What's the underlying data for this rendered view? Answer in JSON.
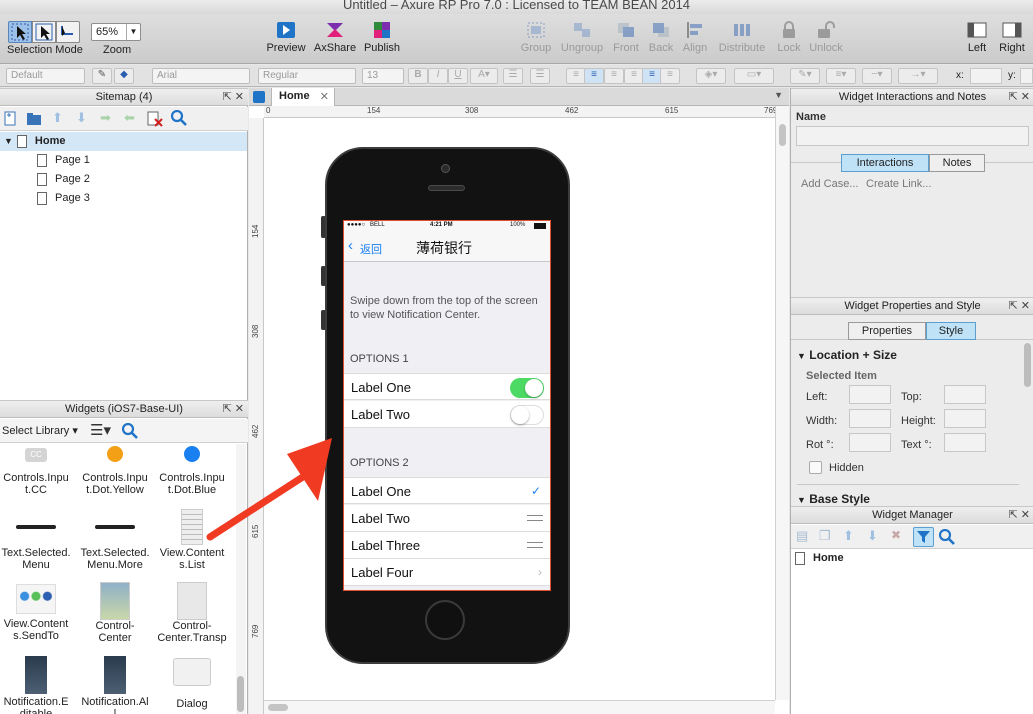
{
  "window": {
    "title": "Untitled – Axure RP Pro 7.0 : Licensed to TEAM BEAN 2014"
  },
  "toolbar": {
    "selection_mode": "Selection Mode",
    "zoom_value": "65%",
    "zoom_label": "Zoom",
    "preview": "Preview",
    "axshare": "AxShare",
    "publish": "Publish",
    "group": "Group",
    "ungroup": "Ungroup",
    "front": "Front",
    "back": "Back",
    "align": "Align",
    "distribute": "Distribute",
    "lock": "Lock",
    "unlock": "Unlock",
    "left": "Left",
    "right": "Right"
  },
  "format": {
    "style": "Default",
    "font": "Arial",
    "weight": "Regular",
    "size": "13",
    "bold": "B",
    "italic": "I",
    "underline": "U",
    "x_label": "x:",
    "y_label": "y:"
  },
  "sitemap": {
    "title": "Sitemap (4)",
    "home": "Home",
    "pages": [
      "Page 1",
      "Page 2",
      "Page 3"
    ]
  },
  "widgets": {
    "title": "Widgets (iOS7-Base-UI)",
    "select_library": "Select Library",
    "items": [
      {
        "l1": "Controls.Inpu",
        "l2": "t.CC"
      },
      {
        "l1": "Controls.Inpu",
        "l2": "t.Dot.Yellow"
      },
      {
        "l1": "Controls.Inpu",
        "l2": "t.Dot.Blue"
      },
      {
        "l1": "Text.Selected.",
        "l2": "Menu"
      },
      {
        "l1": "Text.Selected.",
        "l2": "Menu.More"
      },
      {
        "l1": "View.Content",
        "l2": "s.List"
      },
      {
        "l1": "View.Content",
        "l2": "s.SendTo"
      },
      {
        "l1": "Control-",
        "l2": "Center"
      },
      {
        "l1": "Control-",
        "l2": "Center.Transp"
      },
      {
        "l1": "Notification.E",
        "l2": "ditable"
      },
      {
        "l1": "Notification.Al",
        "l2": "l"
      },
      {
        "l1": "Dialog",
        "l2": ""
      }
    ],
    "cc_badge": "CC"
  },
  "canvas": {
    "tab": "Home",
    "ruler_top": [
      "0",
      "154",
      "308",
      "462",
      "615",
      "769"
    ],
    "ruler_left": [
      "154",
      "308",
      "462",
      "615",
      "769"
    ]
  },
  "phone": {
    "carrier": "BELL",
    "time": "4:21 PM",
    "battery": "100%",
    "back": "返回",
    "nav_title": "薄荷银行",
    "intro": "Swipe down from the top of the screen to view Notification Center.",
    "options1": "OPTIONS 1",
    "opt1_rows": [
      "Label One",
      "Label Two"
    ],
    "options2": "OPTIONS 2",
    "opt2_rows": [
      "Label One",
      "Label Two",
      "Label Three",
      "Label Four"
    ]
  },
  "interactions": {
    "title": "Widget Interactions and Notes",
    "name_label": "Name",
    "tab_interactions": "Interactions",
    "tab_notes": "Notes",
    "add_case": "Add Case...",
    "create_link": "Create Link..."
  },
  "properties": {
    "title": "Widget Properties and Style",
    "tab_properties": "Properties",
    "tab_style": "Style",
    "location_size": "Location + Size",
    "selected_item": "Selected Item",
    "left": "Left:",
    "top": "Top:",
    "width": "Width:",
    "height": "Height:",
    "rot": "Rot °:",
    "text": "Text °:",
    "hidden": "Hidden",
    "base_style": "Base Style"
  },
  "widget_manager": {
    "title": "Widget Manager",
    "home": "Home"
  },
  "colors": {
    "accent": "#3d8fd6",
    "arrow": "#f03a22",
    "toggle_on": "#4cd964"
  }
}
